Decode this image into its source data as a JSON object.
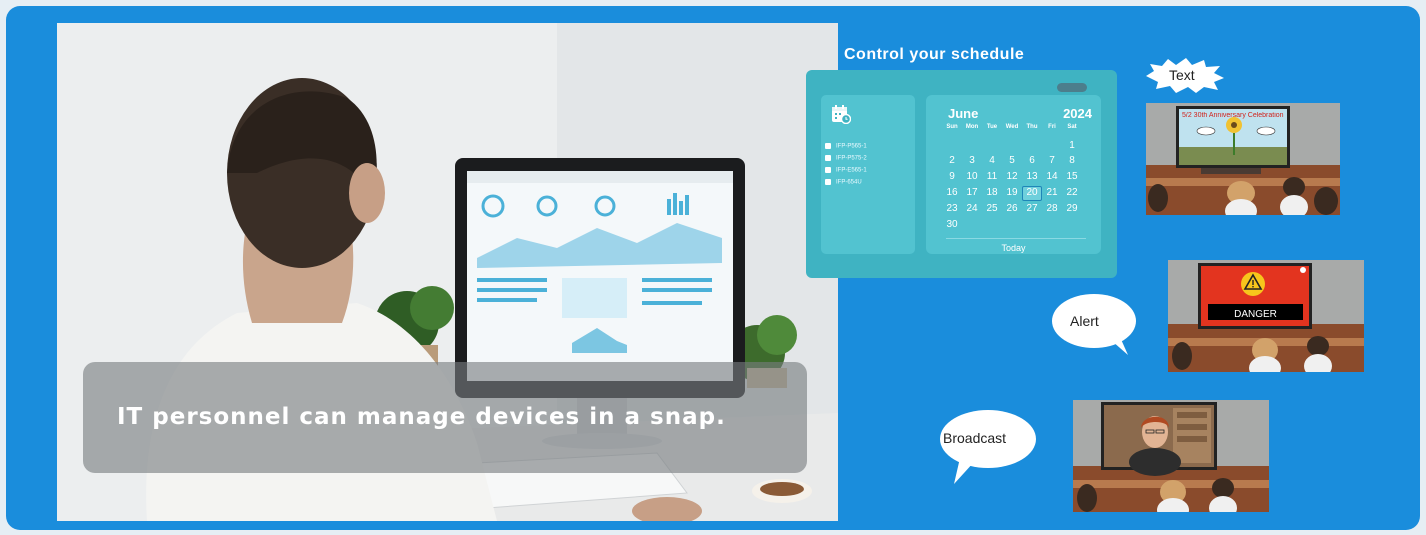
{
  "photo": {
    "caption": "IT personnel can manage devices in a snap."
  },
  "schedule": {
    "title": "Control your schedule",
    "devices": [
      "IFP-P565-1",
      "IFP-P575-2",
      "IFP-E565-1",
      "IFP-654U"
    ],
    "calendar": {
      "month": "June",
      "year": "2024",
      "weekdays": [
        "Sun",
        "Mon",
        "Tue",
        "Wed",
        "Thu",
        "Fri",
        "Sat"
      ],
      "days": [
        "1",
        "2",
        "3",
        "4",
        "5",
        "6",
        "7",
        "8",
        "9",
        "10",
        "11",
        "12",
        "13",
        "14",
        "15",
        "16",
        "17",
        "18",
        "19",
        "20",
        "21",
        "22",
        "23",
        "24",
        "25",
        "26",
        "27",
        "28",
        "29",
        "30"
      ],
      "selected_day": "20",
      "today_label": "Today"
    }
  },
  "bubbles": {
    "text": "Text",
    "alert": "Alert",
    "broadcast": "Broadcast"
  },
  "scenes": {
    "text_banner": "5/2 30th Anniversary Celebration",
    "alert_message": "DANGER"
  },
  "colors": {
    "panel_background": "#1a8ddc",
    "schedule_card": "#3fb3c2",
    "alert_red": "#e3341f"
  }
}
